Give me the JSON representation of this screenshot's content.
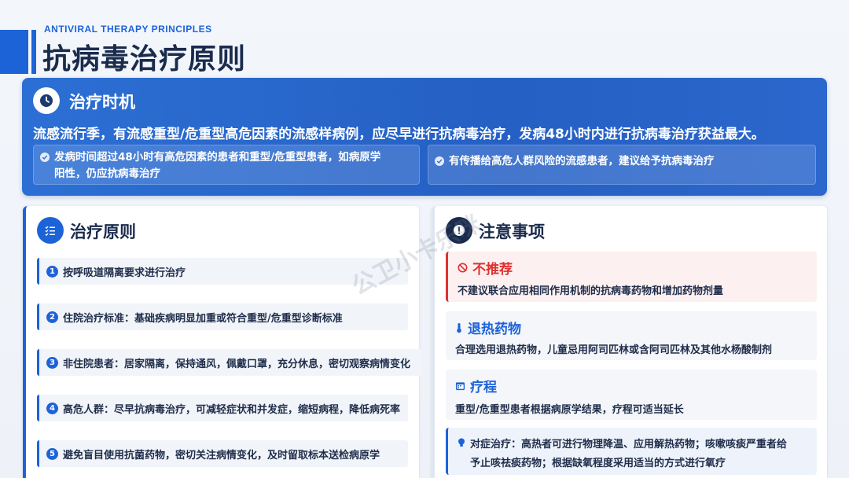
{
  "header": {
    "subtitle": "ANTIVIRAL THERAPY PRINCIPLES",
    "title": "抗病毒治疗原则"
  },
  "timing": {
    "icon": "clock-icon",
    "title": "治疗时机",
    "main": "流感流行季，有流感重型/危重型高危因素的流感样病例，应尽早进行抗病毒治疗，发病48小时内进行抗病毒治疗获益最大。",
    "card1_line1": "发病时间超过48小时有高危因素的患者和重型/危重型患者，如病原学",
    "card1_line2": "阳性，仍应抗病毒治疗",
    "card2": "有传播给高危人群风险的流感患者，建议给予抗病毒治疗"
  },
  "principles": {
    "icon": "checklist-icon",
    "title": "治疗原则",
    "items": [
      {
        "num": "1",
        "text": "按呼吸道隔离要求进行治疗"
      },
      {
        "num": "2",
        "text": "住院治疗标准：基础疾病明显加重或符合重型/危重型诊断标准"
      },
      {
        "num": "3",
        "text": "非住院患者：居家隔离，保持通风，佩戴口罩，充分休息，密切观察病情变化"
      },
      {
        "num": "4",
        "text": "高危人群：尽早抗病毒治疗，可减轻症状和并发症，缩短病程，降低病死率"
      },
      {
        "num": "5",
        "text": "避免盲目使用抗菌药物，密切关注病情变化，及时留取标本送检病原学"
      }
    ]
  },
  "notes": {
    "icon": "alert-icon",
    "title": "注意事项",
    "not_recommended": {
      "icon": "ban-icon",
      "title": "不推荐",
      "text": "不建议联合应用相同作用机制的抗病毒药物和增加药物剂量"
    },
    "antipyretic": {
      "icon": "thermometer-icon",
      "title": "退热药物",
      "text": "合理选用退热药物，儿童忌用阿司匹林或含阿司匹林及其他水杨酸制剂"
    },
    "course": {
      "icon": "calendar-icon",
      "title": "疗程",
      "text": "重型/危重型患者根据病原学结果，疗程可适当延长"
    },
    "symptomatic": {
      "icon": "lightbulb-icon",
      "label": "对症治疗：",
      "line1": "高热者可进行物理降温、应用解热药物；咳嗽咳痰严重者给",
      "line2": "予止咳祛痰药物；根据缺氧程度采用适当的方式进行氧疗"
    }
  },
  "watermark": "公卫小卡乐咪",
  "colors": {
    "accent": "#1d63d8",
    "warning": "#e03030",
    "dark": "#1a2b4c"
  }
}
